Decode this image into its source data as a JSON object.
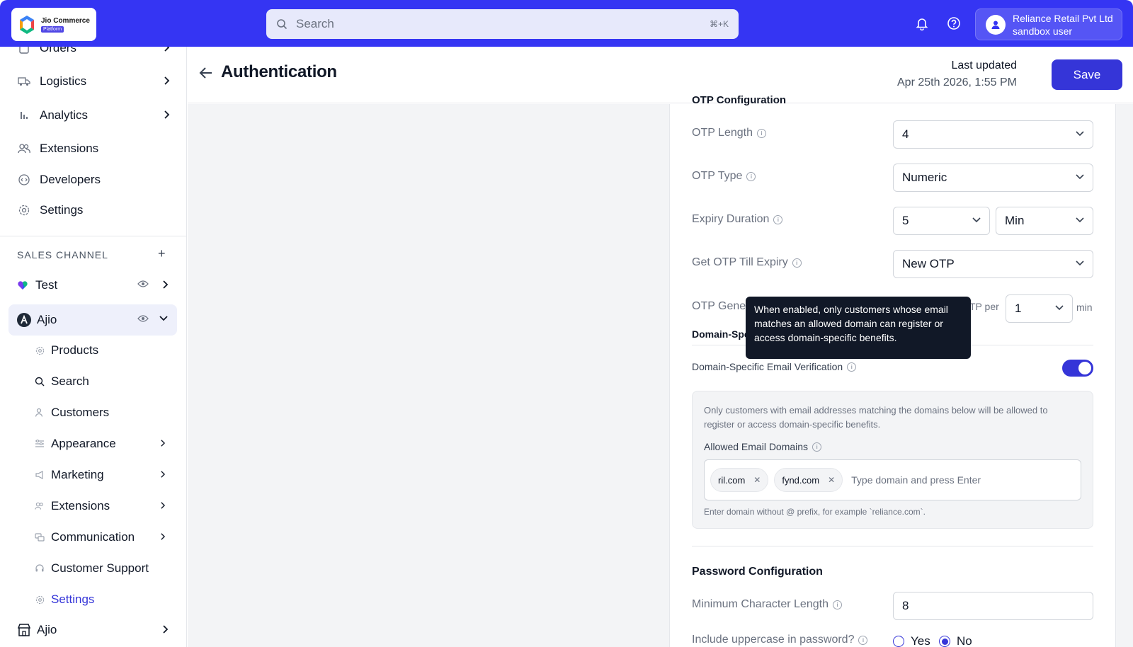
{
  "topbar": {
    "brand": "Jio Commerce",
    "brand_badge": "Platform",
    "search_placeholder": "Search",
    "search_shortcut": "⌘+K",
    "user_org": "Reliance Retail Pvt Ltd",
    "user_name": "sandbox user"
  },
  "sidebar": {
    "items": [
      {
        "label": "Orders",
        "icon": "orders-icon"
      },
      {
        "label": "Logistics",
        "icon": "truck-icon"
      },
      {
        "label": "Analytics",
        "icon": "bar-chart-icon"
      },
      {
        "label": "Extensions",
        "icon": "users-icon"
      },
      {
        "label": "Developers",
        "icon": "code-icon"
      },
      {
        "label": "Settings",
        "icon": "gear-icon"
      }
    ],
    "section_title": "SALES CHANNEL",
    "channels": [
      {
        "label": "Test"
      },
      {
        "label": "Ajio"
      }
    ],
    "sub_items": [
      {
        "label": "Products"
      },
      {
        "label": "Search"
      },
      {
        "label": "Customers"
      },
      {
        "label": "Appearance"
      },
      {
        "label": "Marketing"
      },
      {
        "label": "Extensions"
      },
      {
        "label": "Communication"
      },
      {
        "label": "Customer Support"
      },
      {
        "label": "Settings"
      }
    ],
    "bottom_channel": "Ajio"
  },
  "header": {
    "title": "Authentication",
    "last_updated_label": "Last updated",
    "last_updated_value": "Apr 25th 2026, 1:55 PM",
    "save_label": "Save"
  },
  "otp": {
    "section_title_partial": "OTP Configuration",
    "length_label": "OTP Length",
    "length_value": "4",
    "type_label": "OTP Type",
    "type_value": "Numeric",
    "expiry_label": "Expiry Duration",
    "expiry_value": "5",
    "expiry_unit": "Min",
    "till_expiry_label": "Get OTP Till Expiry",
    "till_expiry_value": "New OTP",
    "generation_label_partial": "OTP Gene",
    "per_text": "TP per",
    "rate_value": "1",
    "rate_unit": "min"
  },
  "domain": {
    "section_partial": "Domain-Spe",
    "verification_label": "Domain-Specific Email Verification",
    "toggle_on": true,
    "description": "Only customers with email addresses matching the domains below will be allowed to register or access domain-specific benefits.",
    "allowed_label": "Allowed Email Domains",
    "chips": [
      "ril.com",
      "fynd.com"
    ],
    "input_placeholder": "Type domain and press Enter",
    "hint": "Enter domain without @ prefix, for example `reliance.com`."
  },
  "password": {
    "section_title": "Password Configuration",
    "min_length_label": "Minimum Character Length",
    "min_length_value": "8",
    "uppercase_label": "Include uppercase in password?",
    "yes_label": "Yes",
    "no_label": "No",
    "selected": "No"
  },
  "tooltip": {
    "text": "When enabled, only customers whose email matches an allowed domain can register or access domain-specific benefits."
  },
  "colors": {
    "accent": "#3535d8",
    "topbar": "#3535f3"
  }
}
